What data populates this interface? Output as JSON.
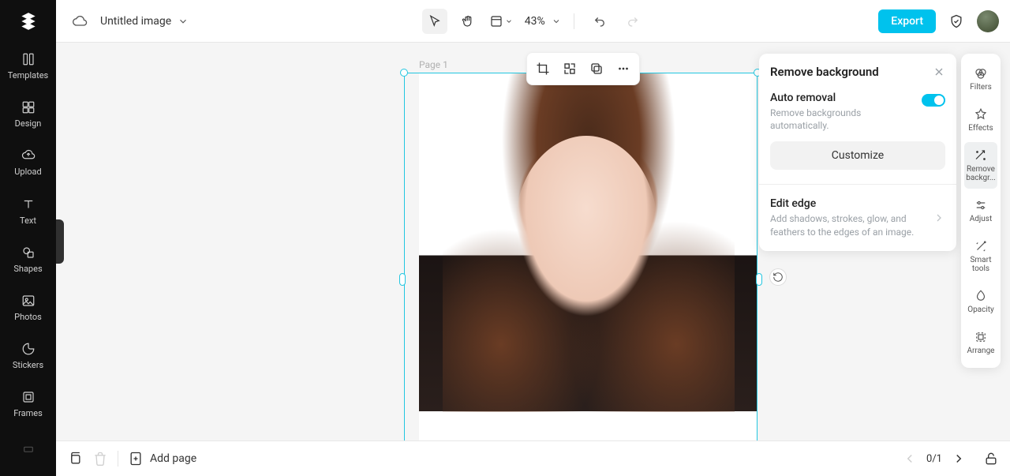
{
  "app": {
    "file_title": "Untitled image",
    "zoom": "43%",
    "export_label": "Export"
  },
  "left_sidebar": {
    "items": [
      {
        "label": "Templates"
      },
      {
        "label": "Design"
      },
      {
        "label": "Upload"
      },
      {
        "label": "Text"
      },
      {
        "label": "Shapes"
      },
      {
        "label": "Photos"
      },
      {
        "label": "Stickers"
      },
      {
        "label": "Frames"
      }
    ]
  },
  "canvas": {
    "page_label": "Page 1"
  },
  "prop_panel": {
    "title": "Remove background",
    "auto_removal": {
      "title": "Auto removal",
      "desc": "Remove backgrounds automatically.",
      "enabled": true
    },
    "customize_label": "Customize",
    "edit_edge": {
      "title": "Edit edge",
      "desc": "Add shadows, strokes, glow, and feathers to the edges of an image."
    }
  },
  "right_tabs": {
    "items": [
      {
        "label": "Filters"
      },
      {
        "label": "Effects"
      },
      {
        "label": "Remove backgr..."
      },
      {
        "label": "Adjust"
      },
      {
        "label": "Smart tools"
      },
      {
        "label": "Opacity"
      },
      {
        "label": "Arrange"
      }
    ],
    "active_index": 2
  },
  "bottom_bar": {
    "add_page_label": "Add page",
    "page_counter": "0/1"
  }
}
